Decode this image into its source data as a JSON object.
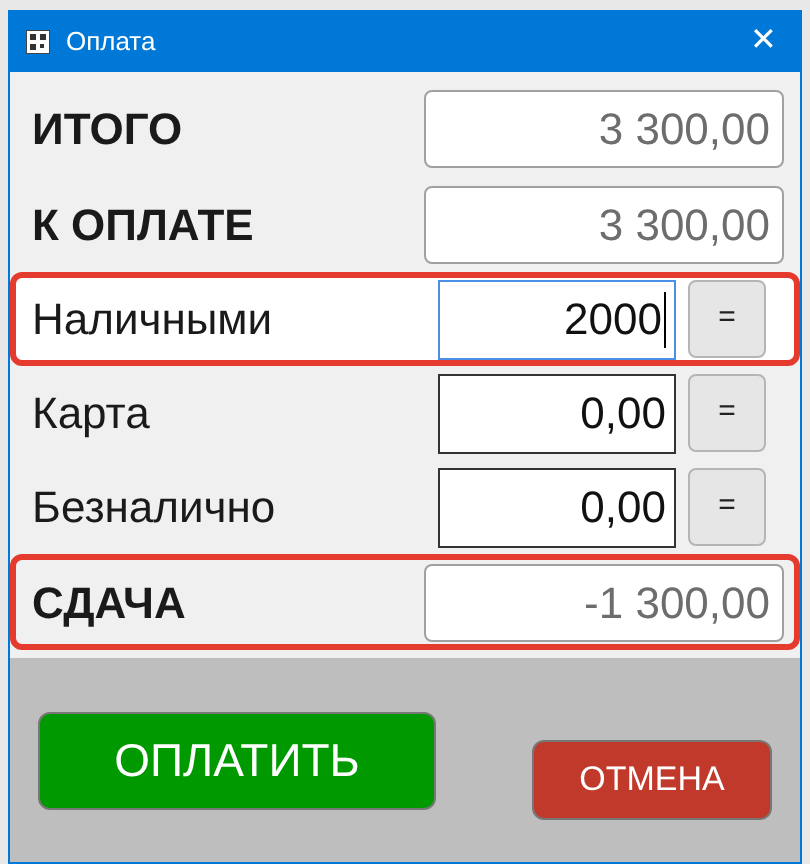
{
  "window": {
    "title": "Оплата",
    "close": "✕"
  },
  "rows": [
    {
      "kind": "total",
      "label": "ИТОГО",
      "value": "3 300,00",
      "highlighted": false
    },
    {
      "kind": "total",
      "label": "К ОПЛАТЕ",
      "value": "3 300,00",
      "highlighted": false
    },
    {
      "kind": "payment",
      "label": "Наличными",
      "value": "2000",
      "button": "=",
      "highlighted": true,
      "focused": true
    },
    {
      "kind": "payment",
      "label": "Карта",
      "value": "0,00",
      "button": "=",
      "highlighted": false,
      "focused": false
    },
    {
      "kind": "payment",
      "label": "Безналично",
      "value": "0,00",
      "button": "=",
      "highlighted": false,
      "focused": false
    },
    {
      "kind": "total",
      "label": "СДАЧА",
      "value": "-1 300,00",
      "highlighted": true
    }
  ],
  "buttons": [
    {
      "kind": "pay",
      "label": "ОПЛАТИТЬ"
    },
    {
      "kind": "cancel",
      "label": "ОТМЕНА"
    }
  ]
}
